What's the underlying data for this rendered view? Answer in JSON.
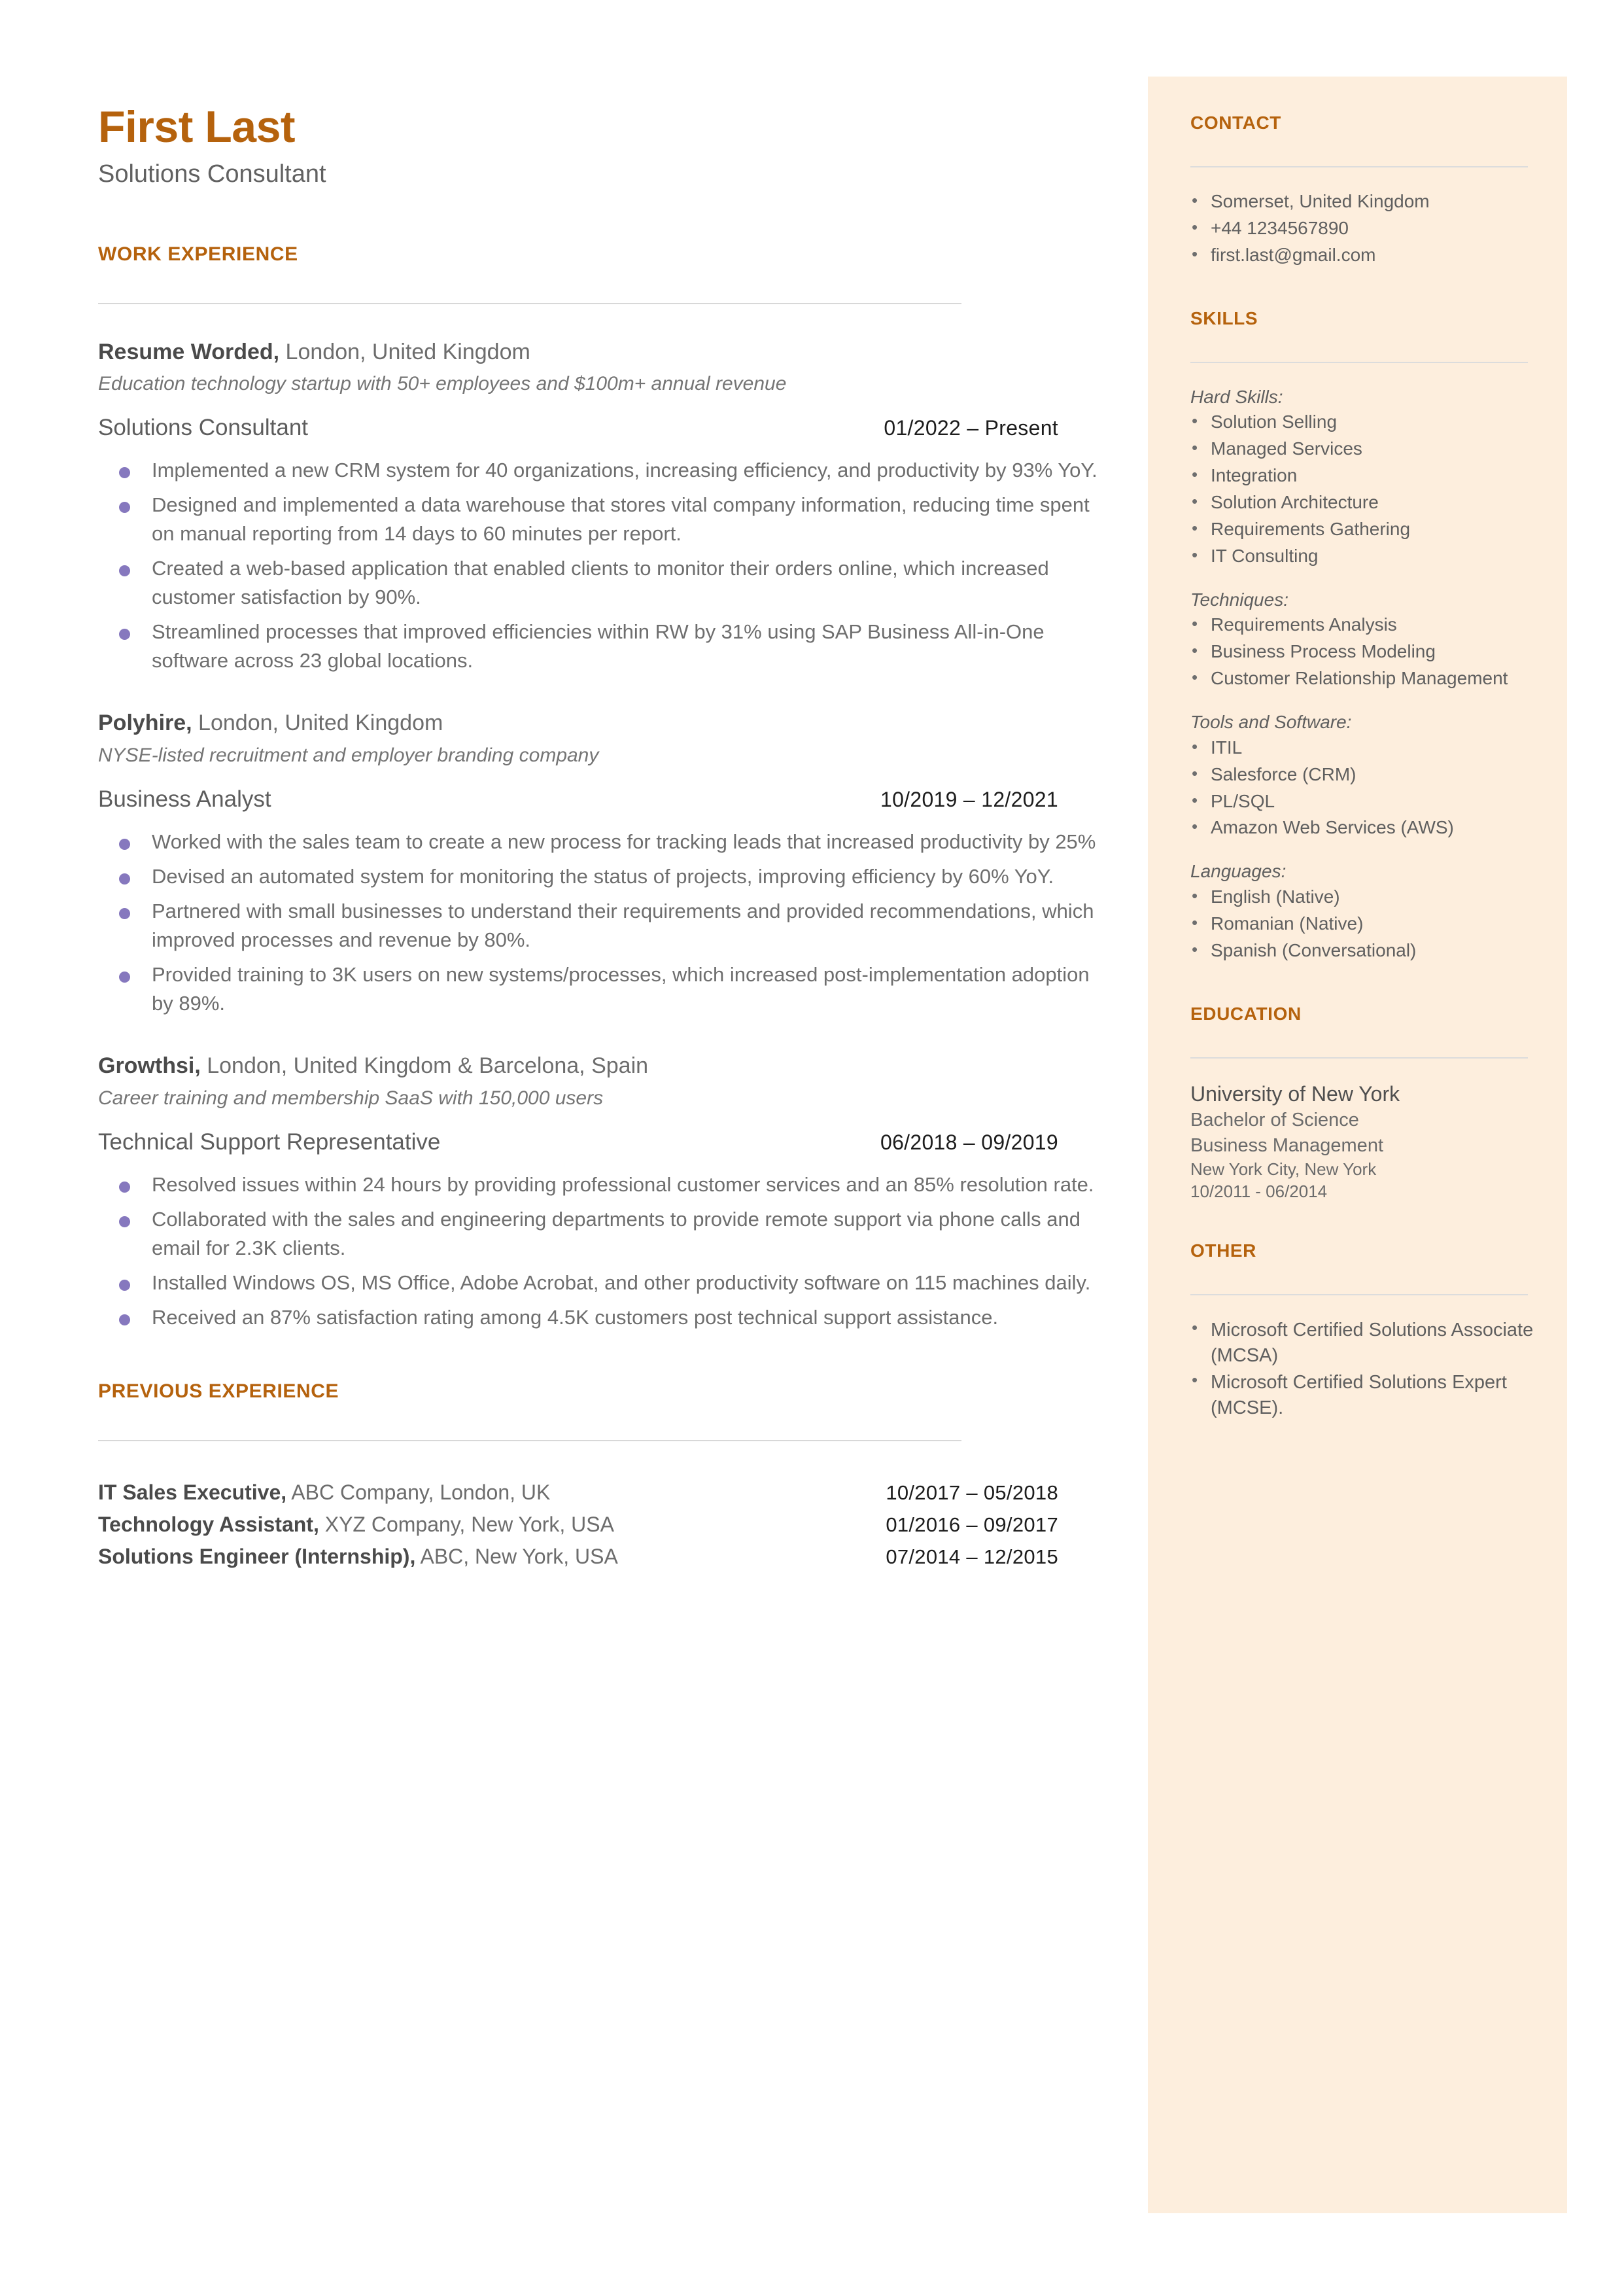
{
  "colors": {
    "accent": "#b5620d",
    "sidebar_bg": "#fdeedd",
    "bullet": "#8678be",
    "body_text": "#6e6e6e",
    "rule": "#d8d8d8"
  },
  "header": {
    "name": "First Last",
    "headline": "Solutions Consultant"
  },
  "work_experience": {
    "section_title": "WORK EXPERIENCE",
    "jobs": [
      {
        "company": "Resume Worded,",
        "location": " London, United Kingdom",
        "description": "Education technology startup with 50+ employees and $100m+ annual revenue",
        "title": "Solutions Consultant",
        "dates": "01/2022 – Present",
        "bullets": [
          "Implemented a new CRM system for 40 organizations, increasing efficiency, and productivity by 93% YoY.",
          "Designed and implemented a data warehouse that stores vital company information, reducing time spent on manual reporting from 14 days to 60 minutes per report.",
          "Created a web-based application that enabled clients to monitor their orders online, which increased customer satisfaction by 90%.",
          "Streamlined processes that improved efficiencies within RW by 31% using SAP Business All-in-One software across 23 global locations."
        ]
      },
      {
        "company": "Polyhire,",
        "location": " London, United Kingdom",
        "description": "NYSE-listed recruitment and employer branding company",
        "title": "Business Analyst",
        "dates": "10/2019 – 12/2021",
        "bullets": [
          "Worked with the sales team to create a new process for tracking leads that increased productivity by 25%",
          "Devised an automated system for monitoring the status of projects, improving efficiency by 60% YoY.",
          "Partnered with small businesses to understand their requirements and provided recommendations, which improved processes and revenue by 80%.",
          "Provided training to 3K users on new systems/processes, which increased post-implementation adoption by 89%."
        ]
      },
      {
        "company": "Growthsi,",
        "location": " London, United Kingdom & Barcelona, Spain",
        "description": "Career training and membership SaaS with 150,000 users",
        "title": "Technical Support Representative",
        "dates": "06/2018 – 09/2019",
        "bullets": [
          "Resolved issues within 24 hours by providing professional customer services and an 85% resolution rate.",
          "Collaborated with the sales and engineering departments to provide remote support via phone calls and email for 2.3K clients.",
          "Installed Windows OS, MS Office, Adobe Acrobat, and other productivity software on 115 machines daily.",
          "Received an 87% satisfaction rating among 4.5K customers post technical support assistance."
        ]
      }
    ]
  },
  "previous_experience": {
    "section_title": "PREVIOUS EXPERIENCE",
    "rows": [
      {
        "title": "IT Sales Executive,",
        "detail": " ABC Company, London, UK",
        "dates": "10/2017 – 05/2018"
      },
      {
        "title": "Technology Assistant,",
        "detail": " XYZ Company, New York, USA",
        "dates": "01/2016 – 09/2017"
      },
      {
        "title": "Solutions Engineer (Internship),",
        "detail": " ABC, New York, USA",
        "dates": "07/2014 – 12/2015"
      }
    ]
  },
  "contact": {
    "section_title": "CONTACT",
    "items": [
      "Somerset, United Kingdom",
      "+44 1234567890",
      "first.last@gmail.com"
    ]
  },
  "skills": {
    "section_title": "SKILLS",
    "groups": [
      {
        "label": "Hard Skills:",
        "items": [
          "Solution Selling",
          "Managed Services",
          "Integration",
          "Solution Architecture",
          "Requirements Gathering",
          "IT Consulting"
        ]
      },
      {
        "label": "Techniques:",
        "items": [
          "Requirements Analysis",
          "Business Process Modeling",
          "Customer Relationship Management"
        ]
      },
      {
        "label": "Tools and Software:",
        "items": [
          "ITIL",
          "Salesforce (CRM)",
          "PL/SQL",
          "Amazon Web Services (AWS)"
        ]
      },
      {
        "label": "Languages:",
        "items": [
          "English (Native)",
          "Romanian (Native)",
          "Spanish (Conversational)"
        ]
      }
    ]
  },
  "education": {
    "section_title": "EDUCATION",
    "school": "University of New York",
    "degree": "Bachelor of Science",
    "major": "Business Management",
    "location": "New York City, New York",
    "dates": "10/2011 - 06/2014"
  },
  "other": {
    "section_title": "OTHER",
    "items": [
      "Microsoft Certified Solutions Associate (MCSA)",
      "Microsoft Certified Solutions Expert (MCSE)."
    ]
  }
}
